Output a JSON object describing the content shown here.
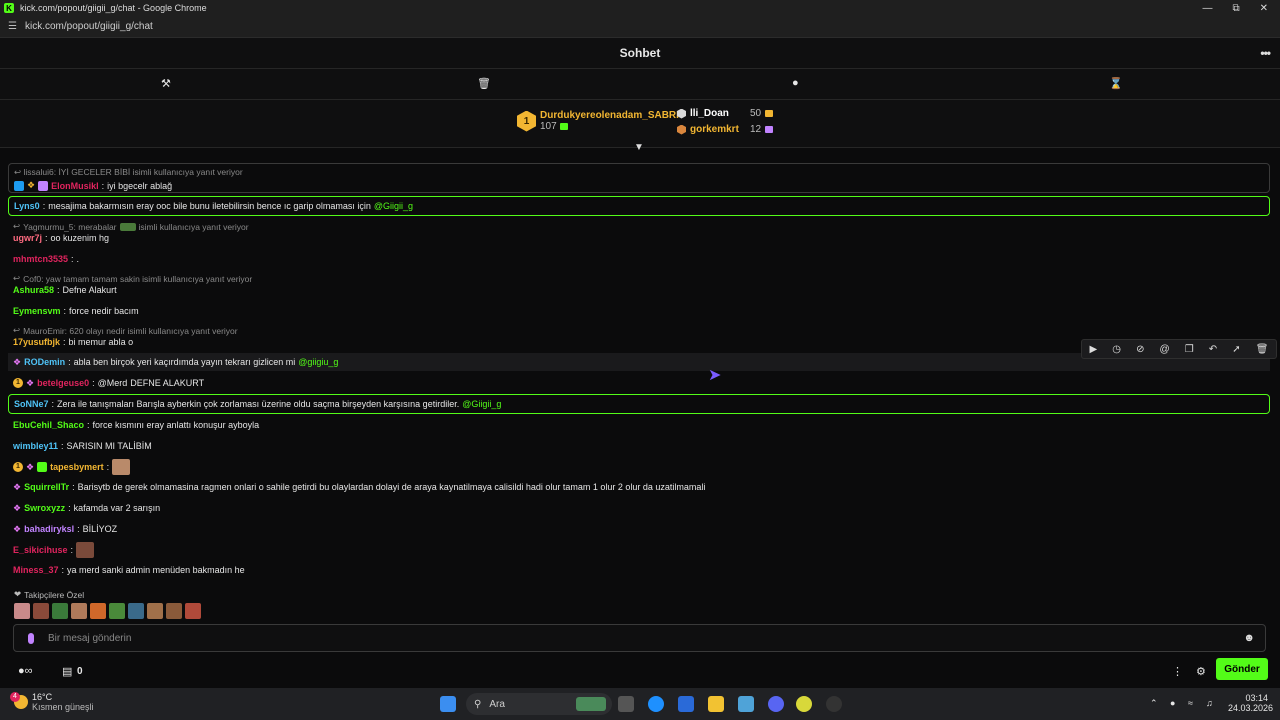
{
  "browser": {
    "title": "kick.com/popout/giigii_g/chat - Google Chrome",
    "url": "kick.com/popout/giigii_g/chat"
  },
  "header": {
    "title": "Sohbet"
  },
  "leaderboard": {
    "first": {
      "rank": "1",
      "name": "Durdukyereolenadam_SABRI",
      "value": "107"
    },
    "second": {
      "name": "lli_Doan",
      "value": "50"
    },
    "third": {
      "name": "gorkemkrt",
      "value": "12"
    }
  },
  "messages": [
    {
      "reply": "lissalui6: İYİ GECELER BİBİ isimli kullanıcıya yanıt veriyor",
      "user": "ElonMusikl",
      "user_color": "#e0245e",
      "text": "iyi bgecelr ablağ",
      "mention": ""
    },
    {
      "reply": "",
      "user": "Lyns0",
      "user_color": "#4fc3f7",
      "text": "mesajima bakarmısın eray ooc bile bunu iletebilirsin bence ıc garip olmaması için",
      "mention": "@Giigii_g"
    },
    {
      "reply": "Yagmurmu_5: merabalar",
      "reply_suffix": "isimli kullanıcıya yanıt veriyor",
      "user": "ugwr7j",
      "user_color": "#ff6b81",
      "text": "oo kuzenim hg",
      "mention": ""
    },
    {
      "reply": "",
      "user": "mhmtcn3535",
      "user_color": "#e0245e",
      "text": ".",
      "mention": ""
    },
    {
      "reply": "Cof0: yaw tamam tamam sakin isimli kullanıcıya yanıt veriyor",
      "user": "Ashura58",
      "user_color": "#53fc18",
      "text": "Defne Alakurt",
      "mention": ""
    },
    {
      "reply": "",
      "user": "Eymensvm",
      "user_color": "#53fc18",
      "text": "force nedir bacım",
      "mention": ""
    },
    {
      "reply": "MauroEmir: 620 olayı nedir isimli kullanıcıya yanıt veriyor",
      "user": "17yusufbjk",
      "user_color": "#f2b632",
      "text": "bi memur abla o",
      "mention": ""
    },
    {
      "reply": "",
      "user": "RODemin",
      "user_color": "#4fc3f7",
      "text": "abla ben birçok yeri kaçırdımda yayın tekrarı gizlicen mi",
      "mention": "@giigiu_g"
    },
    {
      "reply": "",
      "user": "betelgeuse0",
      "user_color": "#e0245e",
      "text": "DEFNE ALAKURT",
      "mention": "@Merd"
    },
    {
      "reply": "",
      "user": "SoNNe7",
      "user_color": "#4fc3f7",
      "text": "Zera ile tanışmaları Barışla ayberkin çok zorlaması üzerine oldu saçma birşeyden karşısına getirdiler.",
      "mention": "@Giigii_g"
    },
    {
      "reply": "",
      "user": "EbuCehil_Shaco",
      "user_color": "#53fc18",
      "text": "force kısmını eray anlattı konuşur ayboyla",
      "mention": ""
    },
    {
      "reply": "",
      "user": "wimbley11",
      "user_color": "#4fc3f7",
      "text": "SARISIN MI TALİBİM",
      "mention": ""
    },
    {
      "reply": "",
      "user": "tapesbymert",
      "user_color": "#f2b632",
      "text": "",
      "mention": ""
    },
    {
      "reply": "",
      "user": "SquirrellTr",
      "user_color": "#53fc18",
      "text": "Barisytb de gerek olmamasina ragmen onlari o sahile getirdi bu olaylardan dolayi de araya kaynatilmaya calisildi hadi olur tamam 1 olur 2 olur da uzatilmamali",
      "mention": ""
    },
    {
      "reply": "",
      "user": "Swroxyzz",
      "user_color": "#53fc18",
      "text": "kafamda var 2 sarışın",
      "mention": ""
    },
    {
      "reply": "",
      "user": "bahadiryksl",
      "user_color": "#c183ff",
      "text": "BİLİYOZ",
      "mention": ""
    },
    {
      "reply": "",
      "user": "E_sikicihuse",
      "user_color": "#e0245e",
      "text": "",
      "mention": ""
    },
    {
      "reply": "",
      "user": "Miness_37",
      "user_color": "#e0245e",
      "text": "ya merd sanki admin menüden bakmadın he",
      "mention": ""
    }
  ],
  "followers_label": "Takipçilere Özel",
  "input": {
    "placeholder": "Bir mesaj gönderin"
  },
  "bottom": {
    "count": "0",
    "send_label": "Gönder"
  },
  "taskbar": {
    "weather_temp": "16°C",
    "weather_desc": "Kısmen güneşli",
    "search_label": "Ara",
    "time": "03:14",
    "date": "24.03.2026",
    "notif": "4"
  },
  "colors": {
    "accent": "#53fc18",
    "gold": "#f2b632",
    "bg": "#0b0b0c"
  }
}
